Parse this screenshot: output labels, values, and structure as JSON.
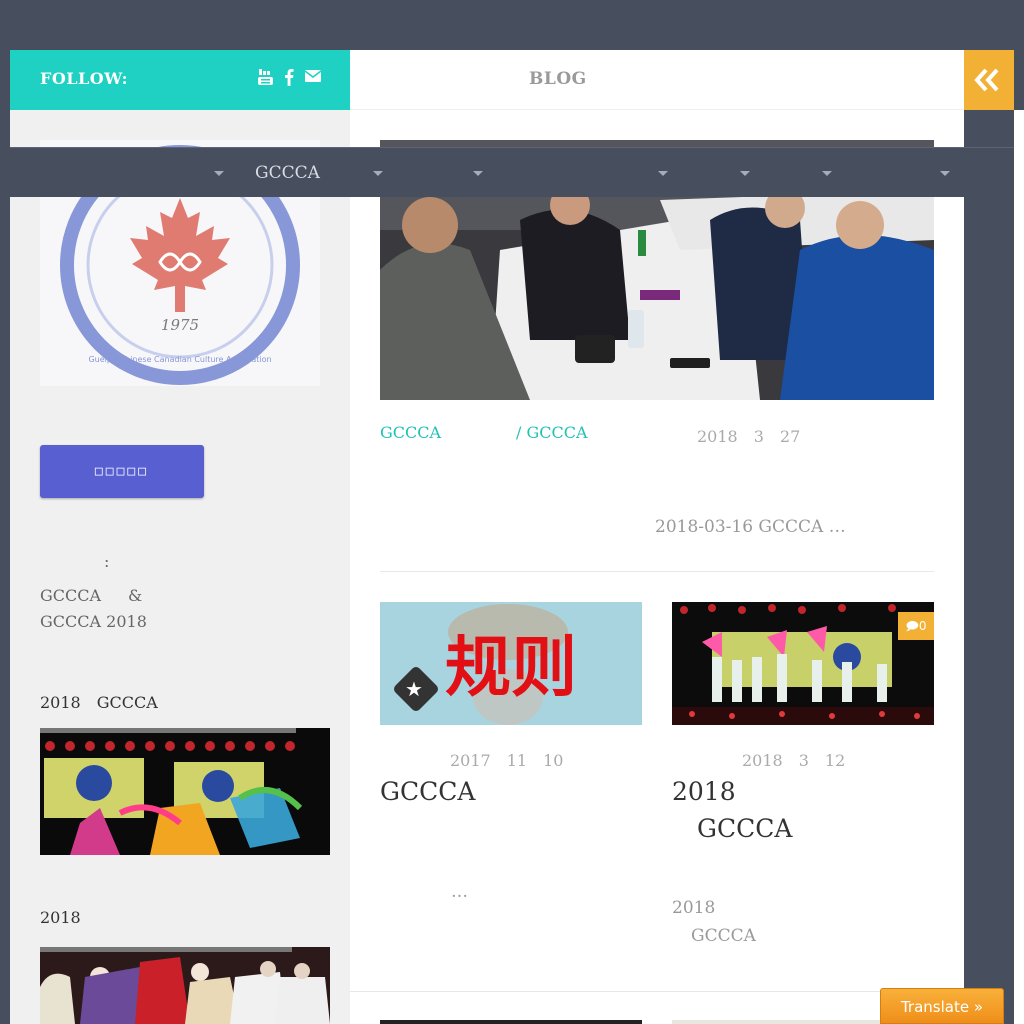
{
  "sidebar": {
    "follow_label": "FOLLOW:",
    "social_icons": [
      "youtube-icon",
      "facebook-icon",
      "envelope-icon"
    ],
    "logo_year": "1975",
    "logo_text_en": "Guelph Chinese Canadian Culture Association",
    "join_button": "□□□□□",
    "widget1": {
      "colon": ":",
      "line1_a": "GCCCA",
      "line1_b": "&",
      "line2": "GCCCA 2018"
    },
    "widget2_title": "2018　GCCCA",
    "widget3_title": "2018"
  },
  "header": {
    "blog_title": "BLOG",
    "collapse_icon": "double-chevron-left-icon"
  },
  "nav": {
    "active_label": "GCCCA"
  },
  "featured_post": {
    "category_a": "GCCCA",
    "category_b": "/ GCCCA",
    "date": "2018　3　27",
    "excerpt": "2018-03-16 GCCCA  …"
  },
  "post_left": {
    "image_text": "规则",
    "date": "2017　11　10",
    "title": "GCCCA",
    "excerpt": "…"
  },
  "post_right": {
    "comment_count": "0",
    "date": "2018　3　12",
    "title_line1": "2018",
    "title_line2": "GCCCA",
    "excerpt_line1": "2018",
    "excerpt_line2": "GCCCA"
  },
  "translate_button": "Translate »",
  "colors": {
    "accent_teal": "#1fd1c2",
    "accent_orange": "#f2b134",
    "dark_bar": "#474e5d",
    "button_blue": "#585fd0"
  }
}
